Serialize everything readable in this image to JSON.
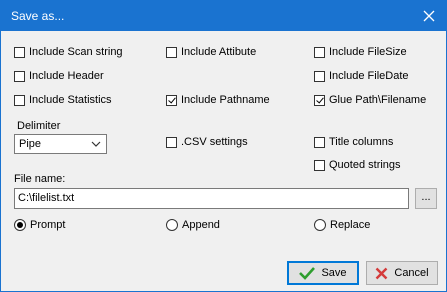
{
  "window": {
    "title": "Save as..."
  },
  "options": {
    "include_scan_string": {
      "label": "Include Scan string",
      "checked": false
    },
    "include_header": {
      "label": "Include Header",
      "checked": false
    },
    "include_statistics": {
      "label": "Include Statistics",
      "checked": false
    },
    "include_attribute": {
      "label": "Include Attibute",
      "checked": false
    },
    "include_pathname": {
      "label": "Include Pathname",
      "checked": true
    },
    "include_filesize": {
      "label": "Include FileSize",
      "checked": false
    },
    "include_filedate": {
      "label": "Include FileDate",
      "checked": false
    },
    "glue_path": {
      "label": "Glue Path\\Filename",
      "checked": true
    },
    "csv_settings": {
      "label": ".CSV settings",
      "checked": false
    },
    "title_columns": {
      "label": "Title columns",
      "checked": false
    },
    "quoted_strings": {
      "label": "Quoted strings",
      "checked": false
    }
  },
  "delimiter": {
    "label": "Delimiter",
    "value": "Pipe"
  },
  "file_name": {
    "label": "File name:",
    "value": "C:\\filelist.txt",
    "browse_label": "..."
  },
  "mode": {
    "selected": "Prompt",
    "prompt": "Prompt",
    "append": "Append",
    "replace": "Replace"
  },
  "buttons": {
    "save": "Save",
    "cancel": "Cancel"
  },
  "colors": {
    "titlebar": "#1a73d0",
    "save_check": "#2e9e2e",
    "cancel_x": "#d43a3a"
  }
}
